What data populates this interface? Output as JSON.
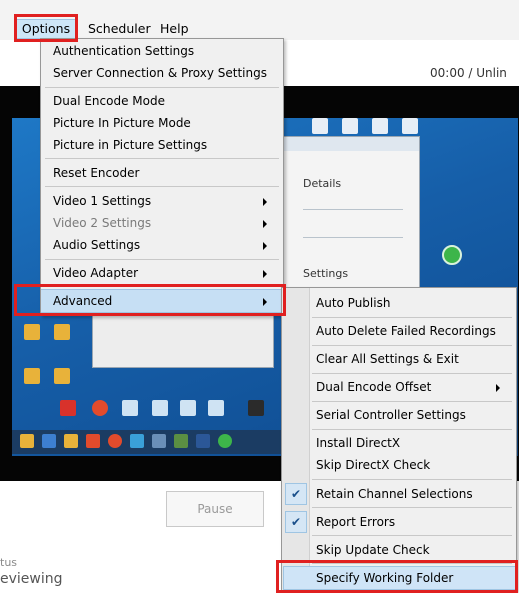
{
  "menubar": {
    "items": [
      {
        "label": "Options"
      },
      {
        "label": "Scheduler"
      },
      {
        "label": "Help"
      }
    ]
  },
  "header": {
    "time_readout": "00:00   /   Unlin"
  },
  "options_menu": {
    "items": [
      {
        "label": "Authentication Settings"
      },
      {
        "label": "Server Connection & Proxy Settings"
      },
      {
        "label": "Dual Encode Mode"
      },
      {
        "label": "Picture In Picture Mode"
      },
      {
        "label": "Picture in Picture Settings"
      },
      {
        "label": "Reset Encoder"
      },
      {
        "label": "Video 1 Settings"
      },
      {
        "label": "Video 2 Settings"
      },
      {
        "label": "Audio Settings"
      },
      {
        "label": "Video Adapter"
      },
      {
        "label": "Advanced"
      }
    ]
  },
  "advanced_menu": {
    "items": [
      {
        "label": "Auto Publish"
      },
      {
        "label": "Auto Delete Failed Recordings"
      },
      {
        "label": "Clear All Settings & Exit"
      },
      {
        "label": "Dual Encode Offset"
      },
      {
        "label": "Serial Controller Settings"
      },
      {
        "label": "Install DirectX"
      },
      {
        "label": "Skip DirectX Check"
      },
      {
        "label": "Retain Channel Selections"
      },
      {
        "label": "Report Errors"
      },
      {
        "label": "Skip Update Check"
      },
      {
        "label": "Specify Working Folder"
      }
    ]
  },
  "preview": {
    "details_label": "Details",
    "settings_label": "Settings"
  },
  "controls": {
    "pause_label": "Pause"
  },
  "status": {
    "caption": "tus",
    "value": "eviewing"
  },
  "colors": {
    "highlight": "#e02020",
    "menu_bg": "#f0f0f0",
    "selection": "#c6dff4"
  }
}
